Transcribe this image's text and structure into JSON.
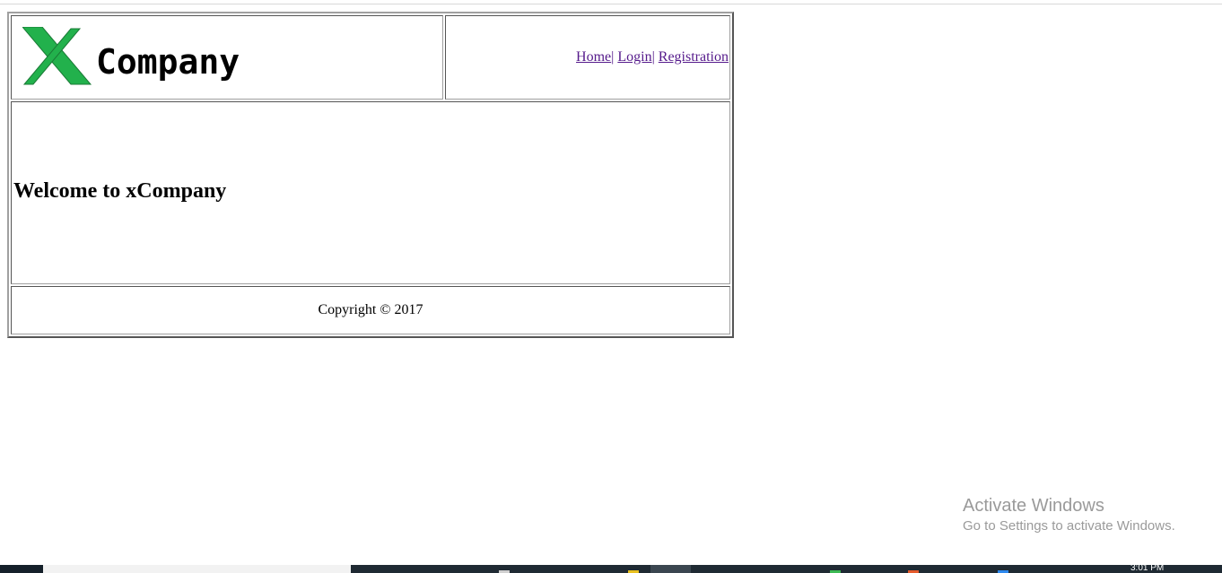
{
  "header": {
    "logo_text": "Company",
    "logo_mark": "X"
  },
  "nav": {
    "home": "Home",
    "login": "Login",
    "registration": "Registration",
    "separator": "|"
  },
  "main": {
    "heading": "Welcome to xCompany"
  },
  "footer": {
    "copyright": "Copyright © 2017"
  },
  "watermark": {
    "title": "Activate Windows",
    "subtitle": "Go to Settings to activate Windows."
  },
  "taskbar": {
    "clock": "3:01 PM"
  },
  "colors": {
    "logo_green": "#22b14c",
    "visited_link": "#551a8b",
    "taskbar": "#1f2a33"
  }
}
